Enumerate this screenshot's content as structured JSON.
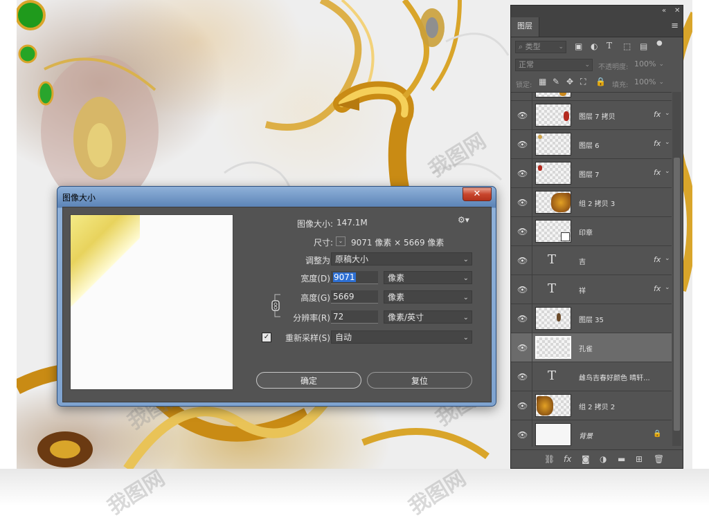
{
  "dialog": {
    "title": "图像大小",
    "close": "✕",
    "image_size_label": "图像大小:",
    "image_size_value": "147.1M",
    "dimensions_label": "尺寸:",
    "dimensions_value": "9071 像素  ×  5669 像素",
    "fit_label": "调整为:",
    "fit_value": "原稿大小",
    "width_label": "宽度(D):",
    "width_value": "9071",
    "width_unit": "像素",
    "height_label": "高度(G):",
    "height_value": "5669",
    "height_unit": "像素",
    "resolution_label": "分辨率(R):",
    "resolution_value": "72",
    "resolution_unit": "像素/英寸",
    "resample_label": "重新采样(S):",
    "resample_checked": true,
    "resample_value": "自动",
    "ok": "确定",
    "reset": "复位"
  },
  "layers_panel": {
    "tab": "图层",
    "filter_kind": "类型",
    "blend_mode": "正常",
    "opacity_label": "不透明度:",
    "opacity_value": "100%",
    "lock_label": "锁定:",
    "fill_label": "填充:",
    "fill_value": "100%",
    "layers": [
      {
        "name": "图层 7 拷贝",
        "type": "pixel",
        "fx": true
      },
      {
        "name": "图层 6",
        "type": "pixel",
        "fx": true
      },
      {
        "name": "图层 7",
        "type": "pixel",
        "fx": true
      },
      {
        "name": "组 2 拷贝 3",
        "type": "pixel",
        "fx": false
      },
      {
        "name": "印章",
        "type": "smart",
        "fx": false
      },
      {
        "name": "吉",
        "type": "text",
        "fx": true
      },
      {
        "name": "祥",
        "type": "text",
        "fx": true
      },
      {
        "name": "图层 35",
        "type": "pixel",
        "fx": false
      },
      {
        "name": "孔雀",
        "type": "pixel",
        "fx": false,
        "selected": true
      },
      {
        "name": "雌鸟吉春好颜色 晴轩...",
        "type": "text",
        "fx": false
      },
      {
        "name": "组 2 拷贝 2",
        "type": "pixel",
        "fx": false
      },
      {
        "name": "背景",
        "type": "background",
        "fx": false,
        "locked": true
      }
    ],
    "fx_label": "fx",
    "text_layer_icon": "T"
  },
  "watermark": "我图网",
  "colors": {
    "panel_bg": "#535353",
    "dialog_title_bg": "#5b83b6",
    "selection_blue": "#2d6fd3",
    "gold": "#d9a52a"
  }
}
